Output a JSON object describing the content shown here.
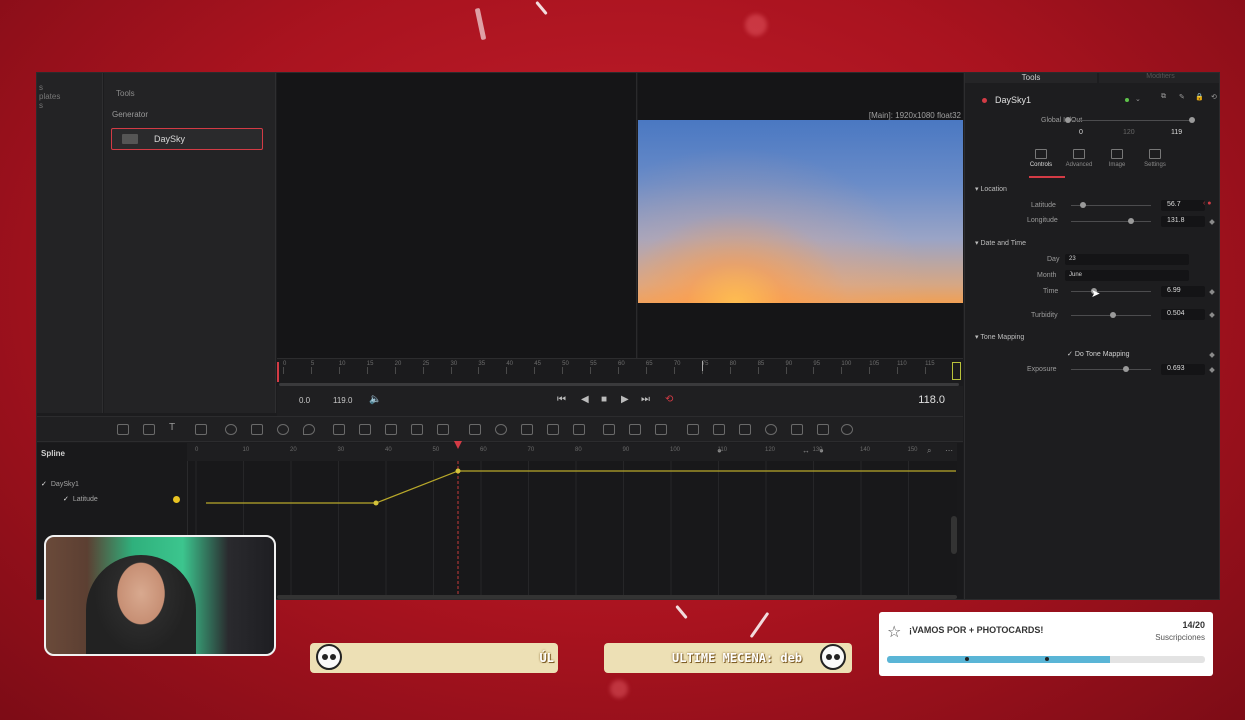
{
  "left_panel": {
    "items": [
      "s",
      "plates",
      "s"
    ]
  },
  "tools_panel": {
    "header": "Tools",
    "category": "Generator",
    "selected_tool": "DaySky"
  },
  "viewer": {
    "resolution_label": "[Main]: 1920x1080 float32"
  },
  "ruler": {
    "ticks": [
      "0",
      "5",
      "10",
      "15",
      "20",
      "25",
      "30",
      "35",
      "40",
      "45",
      "50",
      "55",
      "60",
      "65",
      "70",
      "75",
      "80",
      "85",
      "90",
      "95",
      "100",
      "105",
      "110",
      "115"
    ]
  },
  "transport": {
    "start": "0.0",
    "end": "119.0",
    "current_time": "118.0"
  },
  "spline": {
    "title": "Spline",
    "tree": {
      "node": "DaySky1",
      "param": "Latitude"
    },
    "ruler_ticks": [
      "0",
      "10",
      "20",
      "30",
      "40",
      "50",
      "60",
      "70",
      "80",
      "90",
      "100",
      "110",
      "120",
      "130",
      "140",
      "150"
    ]
  },
  "inspector": {
    "tab_active": "Tools",
    "tab_inactive": "Modifiers",
    "node_name": "DaySky1",
    "global_inout": {
      "label": "Global In/Out",
      "start": "0",
      "mid": "120",
      "end": "119"
    },
    "tabs": [
      "Controls",
      "Advanced",
      "Image",
      "Settings"
    ],
    "location": {
      "section": "Location",
      "latitude": {
        "label": "Latitude",
        "value": "56.7",
        "level": 0.15
      },
      "longitude": {
        "label": "Longitude",
        "value": "131.8",
        "level": 0.75
      }
    },
    "date_time": {
      "section": "Date and Time",
      "day": {
        "label": "Day",
        "value": "23"
      },
      "month": {
        "label": "Month",
        "value": "June"
      },
      "time": {
        "label": "Time",
        "value": "6.99",
        "level": 0.29
      },
      "turbidity": {
        "label": "Turbidity",
        "value": "0.504",
        "level": 0.52
      }
    },
    "tone_mapping": {
      "section": "Tone Mapping",
      "do_tone_mapping": "Do Tone Mapping",
      "exposure": {
        "label": "Exposure",
        "value": "0.693",
        "level": 0.69
      }
    }
  },
  "overlay": {
    "ribbon1_text": "ÚL",
    "ribbon2_text": "ULTIME MECENA: deb",
    "goal": {
      "title": "¡VAMOS POR + PHOTOCARDS!",
      "count": "14/20",
      "subtitle": "Suscripciones",
      "progress": 0.7
    }
  }
}
